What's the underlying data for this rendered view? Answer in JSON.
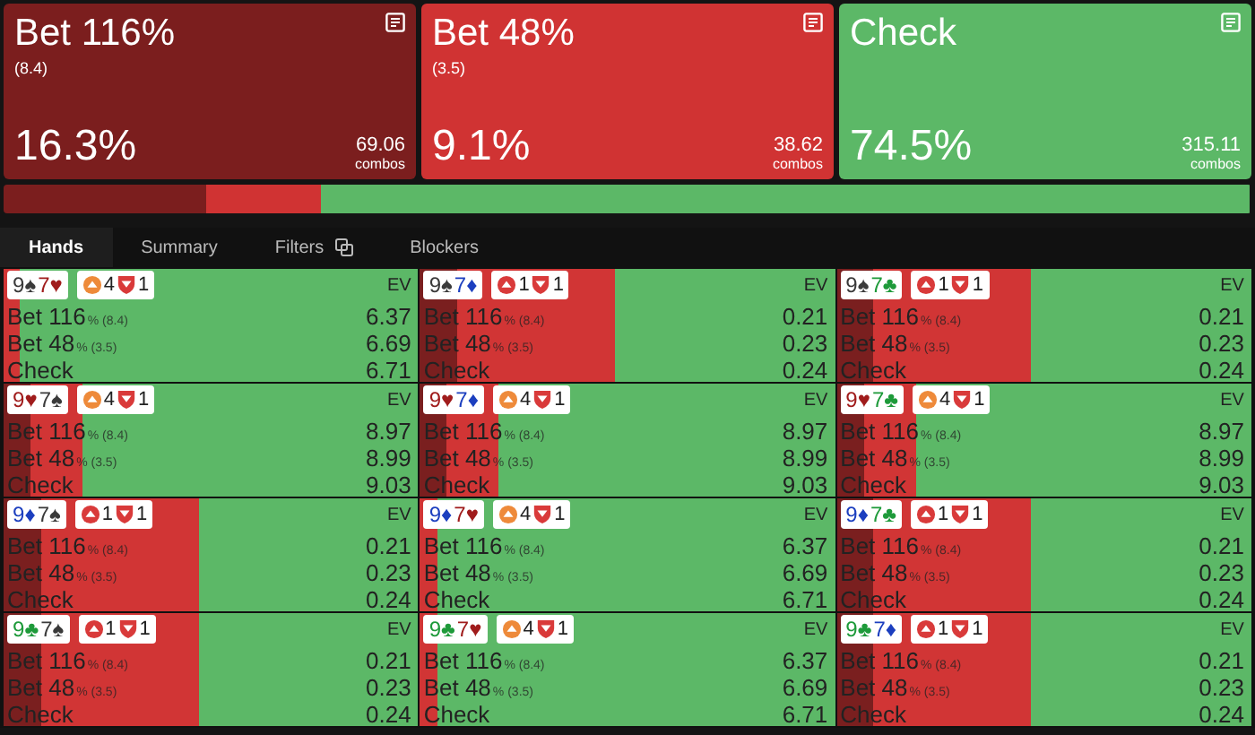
{
  "actions": [
    {
      "title": "Bet 116%",
      "size": "(8.4)",
      "percent": "16.3%",
      "combos": "69.06",
      "combos_label": "combos",
      "color": "#7b1e1e"
    },
    {
      "title": "Bet 48%",
      "size": "(3.5)",
      "percent": "9.1%",
      "combos": "38.62",
      "combos_label": "combos",
      "color": "#d03333"
    },
    {
      "title": "Check",
      "percent": "74.5%",
      "combos": "315.11",
      "combos_label": "combos",
      "color": "#5cb867"
    }
  ],
  "tabs": [
    {
      "label": "Hands",
      "selected": true
    },
    {
      "label": "Summary",
      "selected": false
    },
    {
      "label": "Filters",
      "selected": false,
      "icon": true
    },
    {
      "label": "Blockers",
      "selected": false
    }
  ],
  "cells": [
    {
      "kind": "check",
      "cards": [
        {
          "rank": "9",
          "suit": "♠",
          "color": "#3a3a3a"
        },
        {
          "rank": "7",
          "suit": "♥",
          "color": "#a01c1c"
        }
      ],
      "badges": [
        {
          "kind": "up",
          "color": "#ee8a3a",
          "value": "4"
        },
        {
          "kind": "down",
          "color": "#d93a3a",
          "value": "1"
        }
      ],
      "ev_label": "EV",
      "rows": [
        {
          "label": "Bet 116",
          "suffix": "% (8.4)",
          "ev": "6.37"
        },
        {
          "label": "Bet 48",
          "suffix": "% (3.5)",
          "ev": "6.69"
        },
        {
          "label": "Check",
          "ev": "6.71"
        }
      ]
    },
    {
      "kind": "mixed",
      "cards": [
        {
          "rank": "9",
          "suit": "♠",
          "color": "#3a3a3a"
        },
        {
          "rank": "7",
          "suit": "♦",
          "color": "#1c3fbf"
        }
      ],
      "badges": [
        {
          "kind": "up",
          "color": "#d93a3a",
          "value": "1"
        },
        {
          "kind": "down",
          "color": "#d93a3a",
          "value": "1"
        }
      ],
      "ev_label": "EV",
      "rows": [
        {
          "label": "Bet 116",
          "suffix": "% (8.4)",
          "ev": "0.21"
        },
        {
          "label": "Bet 48",
          "suffix": "% (3.5)",
          "ev": "0.23"
        },
        {
          "label": "Check",
          "ev": "0.24"
        }
      ]
    },
    {
      "kind": "mixed",
      "cards": [
        {
          "rank": "9",
          "suit": "♠",
          "color": "#3a3a3a"
        },
        {
          "rank": "7",
          "suit": "♣",
          "color": "#1e9a3a"
        }
      ],
      "badges": [
        {
          "kind": "up",
          "color": "#d93a3a",
          "value": "1"
        },
        {
          "kind": "down",
          "color": "#d93a3a",
          "value": "1"
        }
      ],
      "ev_label": "EV",
      "rows": [
        {
          "label": "Bet 116",
          "suffix": "% (8.4)",
          "ev": "0.21"
        },
        {
          "label": "Bet 48",
          "suffix": "% (3.5)",
          "ev": "0.23"
        },
        {
          "label": "Check",
          "ev": "0.24"
        }
      ]
    },
    {
      "kind": "light",
      "cards": [
        {
          "rank": "9",
          "suit": "♥",
          "color": "#a01c1c"
        },
        {
          "rank": "7",
          "suit": "♠",
          "color": "#3a3a3a"
        }
      ],
      "badges": [
        {
          "kind": "up",
          "color": "#ee8a3a",
          "value": "4"
        },
        {
          "kind": "down",
          "color": "#d93a3a",
          "value": "1"
        }
      ],
      "ev_label": "EV",
      "rows": [
        {
          "label": "Bet 116",
          "suffix": "% (8.4)",
          "ev": "8.97"
        },
        {
          "label": "Bet 48",
          "suffix": "% (3.5)",
          "ev": "8.99"
        },
        {
          "label": "Check",
          "ev": "9.03"
        }
      ]
    },
    {
      "kind": "light",
      "cards": [
        {
          "rank": "9",
          "suit": "♥",
          "color": "#a01c1c"
        },
        {
          "rank": "7",
          "suit": "♦",
          "color": "#1c3fbf"
        }
      ],
      "badges": [
        {
          "kind": "up",
          "color": "#ee8a3a",
          "value": "4"
        },
        {
          "kind": "down",
          "color": "#d93a3a",
          "value": "1"
        }
      ],
      "ev_label": "EV",
      "rows": [
        {
          "label": "Bet 116",
          "suffix": "% (8.4)",
          "ev": "8.97"
        },
        {
          "label": "Bet 48",
          "suffix": "% (3.5)",
          "ev": "8.99"
        },
        {
          "label": "Check",
          "ev": "9.03"
        }
      ]
    },
    {
      "kind": "light",
      "cards": [
        {
          "rank": "9",
          "suit": "♥",
          "color": "#a01c1c"
        },
        {
          "rank": "7",
          "suit": "♣",
          "color": "#1e9a3a"
        }
      ],
      "badges": [
        {
          "kind": "up",
          "color": "#ee8a3a",
          "value": "4"
        },
        {
          "kind": "down",
          "color": "#d93a3a",
          "value": "1"
        }
      ],
      "ev_label": "EV",
      "rows": [
        {
          "label": "Bet 116",
          "suffix": "% (8.4)",
          "ev": "8.97"
        },
        {
          "label": "Bet 48",
          "suffix": "% (3.5)",
          "ev": "8.99"
        },
        {
          "label": "Check",
          "ev": "9.03"
        }
      ]
    },
    {
      "kind": "mixed",
      "cards": [
        {
          "rank": "9",
          "suit": "♦",
          "color": "#1c3fbf"
        },
        {
          "rank": "7",
          "suit": "♠",
          "color": "#3a3a3a"
        }
      ],
      "badges": [
        {
          "kind": "up",
          "color": "#d93a3a",
          "value": "1"
        },
        {
          "kind": "down",
          "color": "#d93a3a",
          "value": "1"
        }
      ],
      "ev_label": "EV",
      "rows": [
        {
          "label": "Bet 116",
          "suffix": "% (8.4)",
          "ev": "0.21"
        },
        {
          "label": "Bet 48",
          "suffix": "% (3.5)",
          "ev": "0.23"
        },
        {
          "label": "Check",
          "ev": "0.24"
        }
      ]
    },
    {
      "kind": "check",
      "cards": [
        {
          "rank": "9",
          "suit": "♦",
          "color": "#1c3fbf"
        },
        {
          "rank": "7",
          "suit": "♥",
          "color": "#a01c1c"
        }
      ],
      "badges": [
        {
          "kind": "up",
          "color": "#ee8a3a",
          "value": "4"
        },
        {
          "kind": "down",
          "color": "#d93a3a",
          "value": "1"
        }
      ],
      "ev_label": "EV",
      "rows": [
        {
          "label": "Bet 116",
          "suffix": "% (8.4)",
          "ev": "6.37"
        },
        {
          "label": "Bet 48",
          "suffix": "% (3.5)",
          "ev": "6.69"
        },
        {
          "label": "Check",
          "ev": "6.71"
        }
      ]
    },
    {
      "kind": "mixed",
      "cards": [
        {
          "rank": "9",
          "suit": "♦",
          "color": "#1c3fbf"
        },
        {
          "rank": "7",
          "suit": "♣",
          "color": "#1e9a3a"
        }
      ],
      "badges": [
        {
          "kind": "up",
          "color": "#d93a3a",
          "value": "1"
        },
        {
          "kind": "down",
          "color": "#d93a3a",
          "value": "1"
        }
      ],
      "ev_label": "EV",
      "rows": [
        {
          "label": "Bet 116",
          "suffix": "% (8.4)",
          "ev": "0.21"
        },
        {
          "label": "Bet 48",
          "suffix": "% (3.5)",
          "ev": "0.23"
        },
        {
          "label": "Check",
          "ev": "0.24"
        }
      ]
    },
    {
      "kind": "mixed",
      "cards": [
        {
          "rank": "9",
          "suit": "♣",
          "color": "#1e9a3a"
        },
        {
          "rank": "7",
          "suit": "♠",
          "color": "#3a3a3a"
        }
      ],
      "badges": [
        {
          "kind": "up",
          "color": "#d93a3a",
          "value": "1"
        },
        {
          "kind": "down",
          "color": "#d93a3a",
          "value": "1"
        }
      ],
      "ev_label": "EV",
      "rows": [
        {
          "label": "Bet 116",
          "suffix": "% (8.4)",
          "ev": "0.21"
        },
        {
          "label": "Bet 48",
          "suffix": "% (3.5)",
          "ev": "0.23"
        },
        {
          "label": "Check",
          "ev": "0.24"
        }
      ]
    },
    {
      "kind": "check",
      "cards": [
        {
          "rank": "9",
          "suit": "♣",
          "color": "#1e9a3a"
        },
        {
          "rank": "7",
          "suit": "♥",
          "color": "#a01c1c"
        }
      ],
      "badges": [
        {
          "kind": "up",
          "color": "#ee8a3a",
          "value": "4"
        },
        {
          "kind": "down",
          "color": "#d93a3a",
          "value": "1"
        }
      ],
      "ev_label": "EV",
      "rows": [
        {
          "label": "Bet 116",
          "suffix": "% (8.4)",
          "ev": "6.37"
        },
        {
          "label": "Bet 48",
          "suffix": "% (3.5)",
          "ev": "6.69"
        },
        {
          "label": "Check",
          "ev": "6.71"
        }
      ]
    },
    {
      "kind": "mixed",
      "cards": [
        {
          "rank": "9",
          "suit": "♣",
          "color": "#1e9a3a"
        },
        {
          "rank": "7",
          "suit": "♦",
          "color": "#1c3fbf"
        }
      ],
      "badges": [
        {
          "kind": "up",
          "color": "#d93a3a",
          "value": "1"
        },
        {
          "kind": "down",
          "color": "#d93a3a",
          "value": "1"
        }
      ],
      "ev_label": "EV",
      "rows": [
        {
          "label": "Bet 116",
          "suffix": "% (8.4)",
          "ev": "0.21"
        },
        {
          "label": "Bet 48",
          "suffix": "% (3.5)",
          "ev": "0.23"
        },
        {
          "label": "Check",
          "ev": "0.24"
        }
      ]
    }
  ]
}
